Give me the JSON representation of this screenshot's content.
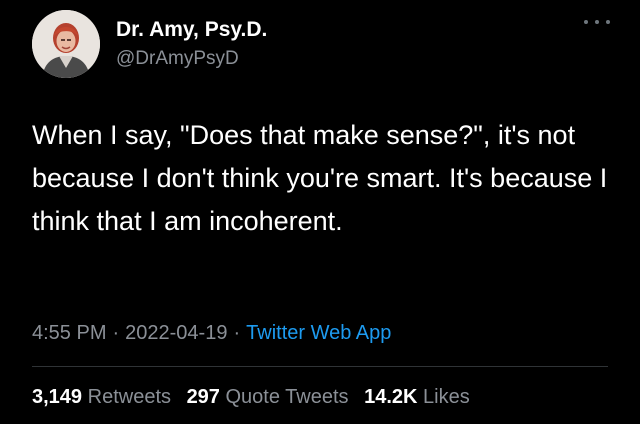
{
  "author": {
    "display_name": "Dr. Amy, Psy.D.",
    "handle": "@DrAmyPsyD",
    "avatar_icon": "profile-photo"
  },
  "menu": {
    "icon": "more-options-icon"
  },
  "tweet": {
    "text": "When I say, \"Does that make sense?\", it's not because I don't think you're smart. It's because I think that I am incoherent."
  },
  "meta": {
    "time": "4:55 PM",
    "separator": "·",
    "date": "2022-04-19",
    "source": "Twitter Web App"
  },
  "stats": {
    "retweets_count": "3,149",
    "retweets_label": "Retweets",
    "quote_tweets_count": "297",
    "quote_tweets_label": "Quote Tweets",
    "likes_count": "14.2K",
    "likes_label": "Likes"
  },
  "colors": {
    "background": "#000000",
    "text_primary": "#ffffff",
    "text_secondary": "#8b9097",
    "link": "#1d9bf0",
    "divider": "#2f3336"
  }
}
